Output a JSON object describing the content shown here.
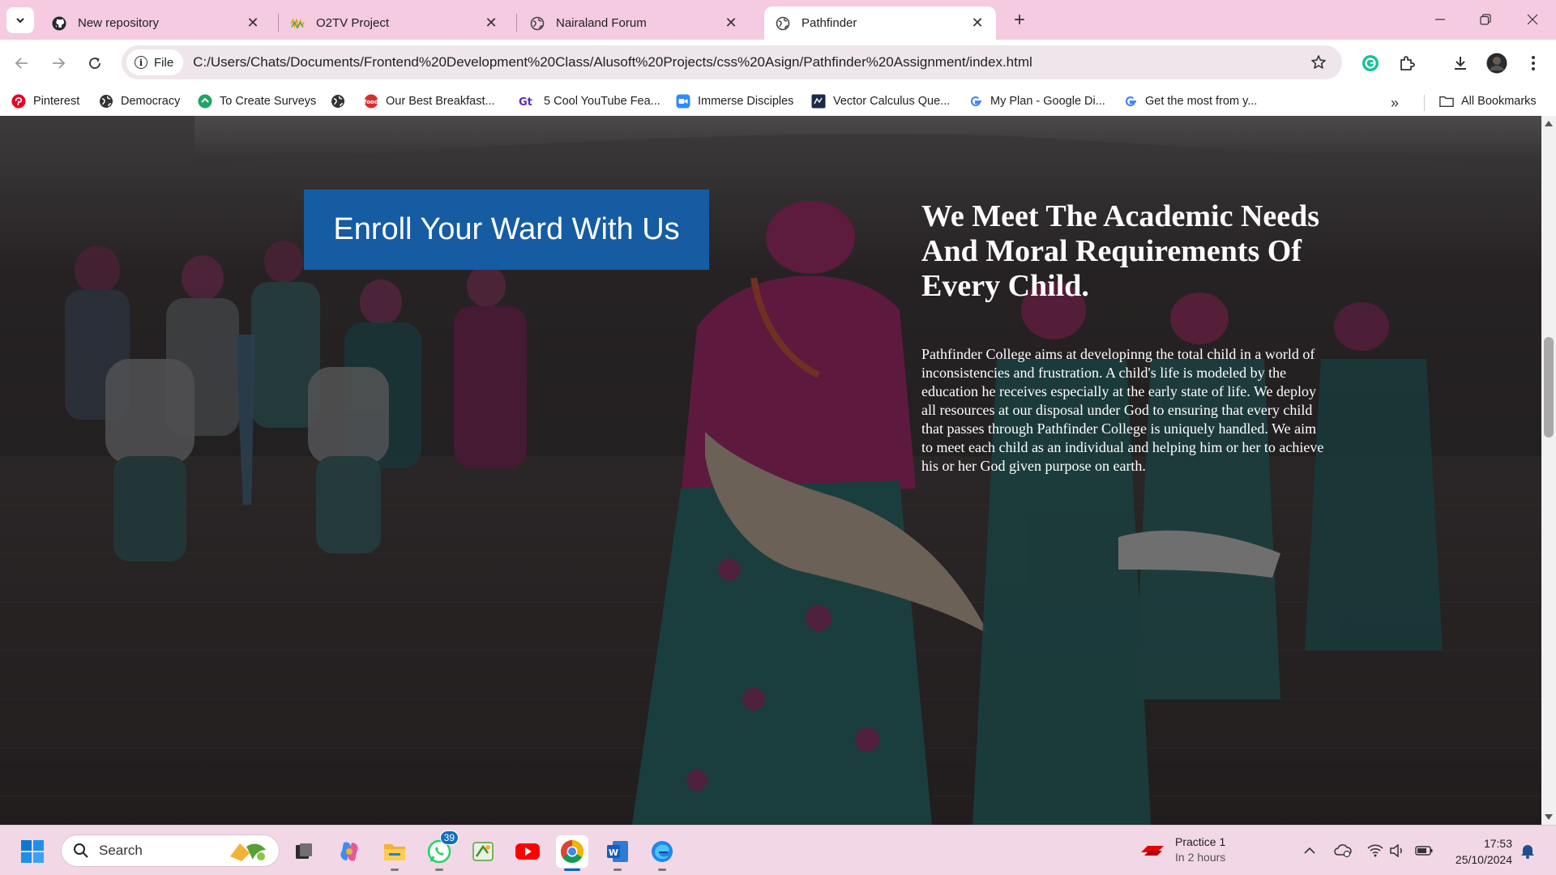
{
  "browser": {
    "tabs": [
      {
        "title": "New repository",
        "favicon": "github-icon",
        "active": false
      },
      {
        "title": "O2TV Project",
        "favicon": "o2tv-icon",
        "active": false
      },
      {
        "title": "Nairaland Forum",
        "favicon": "globe-icon",
        "active": false
      },
      {
        "title": "Pathfinder",
        "favicon": "globe-icon",
        "active": true
      }
    ],
    "new_tab_symbol": "+",
    "site_chip_label": "File",
    "url": "C:/Users/Chats/Documents/Frontend%20Development%20Class/Alusoft%20Projects/css%20Asign/Pathfinder%20Assignment/index.html",
    "bookmarks": [
      {
        "label": "Pinterest",
        "icon": "pinterest-icon"
      },
      {
        "label": "Democracy",
        "icon": "globe-icon"
      },
      {
        "label": "To Create Surveys",
        "icon": "survey-icon"
      },
      {
        "label": "",
        "icon": "globe-icon"
      },
      {
        "label": "Our Best Breakfast...",
        "icon": "food-icon"
      },
      {
        "label": "5 Cool YouTube Fea...",
        "icon": "gt-icon"
      },
      {
        "label": "Immerse Disciples",
        "icon": "zoom-icon"
      },
      {
        "label": "Vector Calculus Que...",
        "icon": "book-icon"
      },
      {
        "label": "My Plan - Google Di...",
        "icon": "google-icon"
      },
      {
        "label": "Get the most from y...",
        "icon": "google-icon"
      }
    ],
    "all_bookmarks_label": "All Bookmarks",
    "more_symbol": "»"
  },
  "page": {
    "enroll_button": "Enroll Your Ward With Us",
    "heading": "We Meet The Academic Needs And Moral Requirements Of Every Child.",
    "paragraph": "Pathfinder College aims at developinng the total child in a world of inconsistencies and frustration. A child's life is modeled by the education he receives especially at the early state of life. We deploy all resources at our disposal under God to ensuring that every child that passes through Pathfinder College is uniquely handled. We aim to meet each child as an individual and helping him or her to achieve his or her God given purpose on earth."
  },
  "taskbar": {
    "search_label": "Search",
    "whatsapp_badge": "39",
    "weather_title": "Practice 1",
    "weather_subtitle": "In 2 hours",
    "time": "17:53",
    "date": "25/10/2024",
    "apps": [
      "start-icon",
      "task-view-icon",
      "copilot-icon",
      "file-explorer-icon",
      "whatsapp-icon",
      "paint-icon",
      "youtube-icon",
      "chrome-icon",
      "word-icon",
      "edge-icon"
    ]
  },
  "colors": {
    "tabstrip": "#f4cbe0",
    "enroll_button": "#155ca2",
    "taskbar": "#f2d7e6"
  }
}
